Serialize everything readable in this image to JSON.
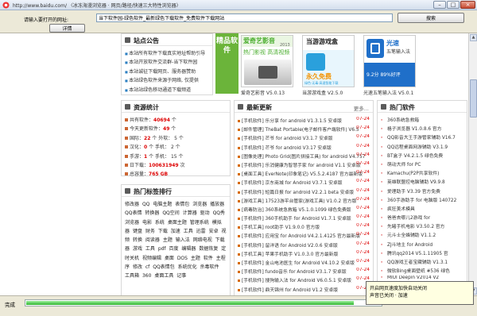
{
  "window": {
    "title": "http://www.baidu.com/ 〈冰冻海漫浏览器 · 网页/路径/快速三大特性浏览器〉",
    "buttons": {
      "minimize": "–",
      "maximize": "□",
      "close": "×"
    }
  },
  "toolbar": {
    "url_label": "请输入要打开的网址:",
    "url_value": "当下软件园-绿色软件_最新绿色下载软件_免费软件下载网站",
    "go_label": "搜索",
    "detail_label": "详情"
  },
  "announce": {
    "title": "站点公告",
    "items": [
      "本站所有软件下载真实地址帮助引导",
      "本站开放软件交流群-当下软件园",
      "本站诚征下载网页、服务器赞助",
      "本站绿色软件来源于网络, 仅提供",
      "本站站绿色移动通道下载频道"
    ]
  },
  "featured": {
    "badge": "精品软件",
    "items": [
      {
        "caption": "爱奇艺影音 V5.0.13",
        "banner": "爱奇艺影音",
        "tag": "热门影视 高清视频",
        "year": "2013",
        "color": "#4bae2f"
      },
      {
        "caption": "当游游戏盒 V2.5.0",
        "banner": "当游游戏盒",
        "tag": "永久免费",
        "sub": "绿色·无毒·高速智能下载",
        "color": "#2aa0dc"
      },
      {
        "caption": "光速五笔输入法 V5.0.1",
        "banner": "光速",
        "tag": "五笔输入法",
        "ver": "9.2分 89%好评",
        "color": "#1f6fc9"
      }
    ]
  },
  "stats": {
    "title": "资源统计",
    "rows": [
      {
        "label": "共有软件：",
        "value": "40694",
        "unit": "个"
      },
      {
        "label": "今天更新软件：",
        "value": "49",
        "unit": "个"
      },
      {
        "label": "国际：",
        "value": "22",
        "unit": "个 外软： 5 个"
      },
      {
        "label": "汉化：",
        "value": "0",
        "unit": "个 手机： 2 个"
      },
      {
        "label": "手游：",
        "value": "1",
        "unit": "个 手机： 15 个"
      },
      {
        "label": "日下载：",
        "value": "100631949",
        "unit": "次"
      },
      {
        "label": "总容量：",
        "value": "765 GB",
        "unit": ""
      }
    ]
  },
  "latest": {
    "title": "最新更新",
    "more": "更多...",
    "items": [
      {
        "text": "[手机软件] 乐分享 for android V1.3.1.5 安卓版",
        "date": "07-24"
      },
      {
        "text": "[邮件管理] TheBat Portable(电子邮件客户端软件) V6.5",
        "date": "07-24"
      },
      {
        "text": "[手机软件] 芒爷 for android V3.1.7 安卓版",
        "date": "07-24"
      },
      {
        "text": "[手机软件] 芒爷 for android V3.17 安卓版",
        "date": "07-24"
      },
      {
        "text": "[图像处理] Photo Grid(图片拼接工具) for android V4.757",
        "date": "07-24"
      },
      {
        "text": "[手机软件] 乐消健康为智慧手家 for android V1.1 安卓版",
        "date": "07-24"
      },
      {
        "text": "[桌面工具] EverNote(印象笔记) V5.5.2.4187 官方最新版",
        "date": "07-24"
      },
      {
        "text": "[手机软件] 京东商城 for Android V3.7.1 安卓版",
        "date": "07-24"
      },
      {
        "text": "[手机软件] 短篇日报 for android V2.2.1 beta 安卓版",
        "date": "07-24"
      },
      {
        "text": "[游戏工具] 17523游平台管家(游戏工具) V1.0.2 官方版",
        "date": "07-24"
      },
      {
        "text": "[病毒防治] 360系统急救箱 V5.1.0.1099 绿色免费版",
        "date": "07-24"
      },
      {
        "text": "[手机软件] 360手机助手 for Android V1.7.1 安卓版",
        "date": "07-24"
      },
      {
        "text": "[手机工具] root助手 V1.9.0.0 官方版",
        "date": "07-24"
      },
      {
        "text": "[手机软件] 应用宝 for Android V4.2.1.4125 官方最新版",
        "date": "07-24"
      },
      {
        "text": "[手机软件] 留洋语 for Android V2.0.6 安卓版",
        "date": "07-24"
      },
      {
        "text": "[手机工具] 苹果手机助手 V1.0.3.0 官方最新版",
        "date": "07-24"
      },
      {
        "text": "[手机软件] 金山电池医生 for Android V4.10.2 安卓版",
        "date": "07-24"
      },
      {
        "text": "[手机软件] fundo音乐 for Android V3.1.7 安卓版",
        "date": "07-24"
      },
      {
        "text": "[手机软件] 搜狗输入法 for Android V6.0.5.1 安卓版",
        "date": "07-24"
      },
      {
        "text": "[手机软件] 鼎天锦州 for Android V1.2 安卓版",
        "date": "07-24"
      }
    ]
  },
  "hot": {
    "title": "热门软件",
    "items": [
      "360系统急救箱",
      "格子浏览器 V1.0.8.6 官方",
      "QQ影音大王手游管家辅助 V16.7",
      "QQ远程桌面网游辅助 V3.1.9",
      "BT盒子 V4.2.1.5 绿色免费",
      "萌动大师 for PC",
      "Kamachu(P2P共享软件)",
      "英雄联盟控电脑辅助 V9.9.8",
      "爱理助手 V3.39 官方免费",
      "360手游助手 for 电脑版 140722",
      "疯狂美术模具",
      "爸爸去哪儿2游戏 for",
      "先睹手机电影 V3.50.2 官方",
      "元斗士全蜂辅助 V1.1.2",
      "ZJ斗地主 for Android",
      "腾讯qq2014 V5.1.11905 官",
      "QQ游戏王者宝藏辅助 V1.3.1",
      "微软Bing桌面壁纸 #536 绿色",
      "MIUI Deepin V2014 V2",
      "QQ文字生成器 V3.0 sourc",
      "SQL Server 2008 R2 免安"
    ]
  },
  "tags": {
    "title": "热门标签排行",
    "items": [
      "修改器",
      "QQ",
      "电脑主题",
      "表情包",
      "浏览器",
      "播放器",
      "QQ表情",
      "转换器",
      "QQ空间",
      "计算器",
      "驱动",
      "QQ秀",
      "浏览器",
      "电影",
      "系统",
      "桌面主题",
      "管理系统",
      "模拟器",
      "键盘",
      "财务",
      "下载",
      "加速",
      "工具",
      "迅雷",
      "安卓",
      "视频",
      "转换",
      "阅读器",
      "主题",
      "输入法",
      "网络电视",
      "下载器",
      "游戏",
      "工具",
      "pdf",
      "百度",
      "编辑器",
      "数据恢复",
      "定时关机",
      "视频编辑",
      "桌面",
      "DOS",
      "主题",
      "软件",
      "主程序",
      "修改",
      "cf",
      "QQ表情包",
      "系统优化",
      "杀毒软件",
      "工具箱",
      "360",
      "桌面工具",
      "记事"
    ]
  },
  "status": {
    "text": "完成",
    "progress": 0.92,
    "tooltip_lines": [
      "开启网页速度加快自动关闭",
      "声音已关闭 · 加速"
    ]
  }
}
